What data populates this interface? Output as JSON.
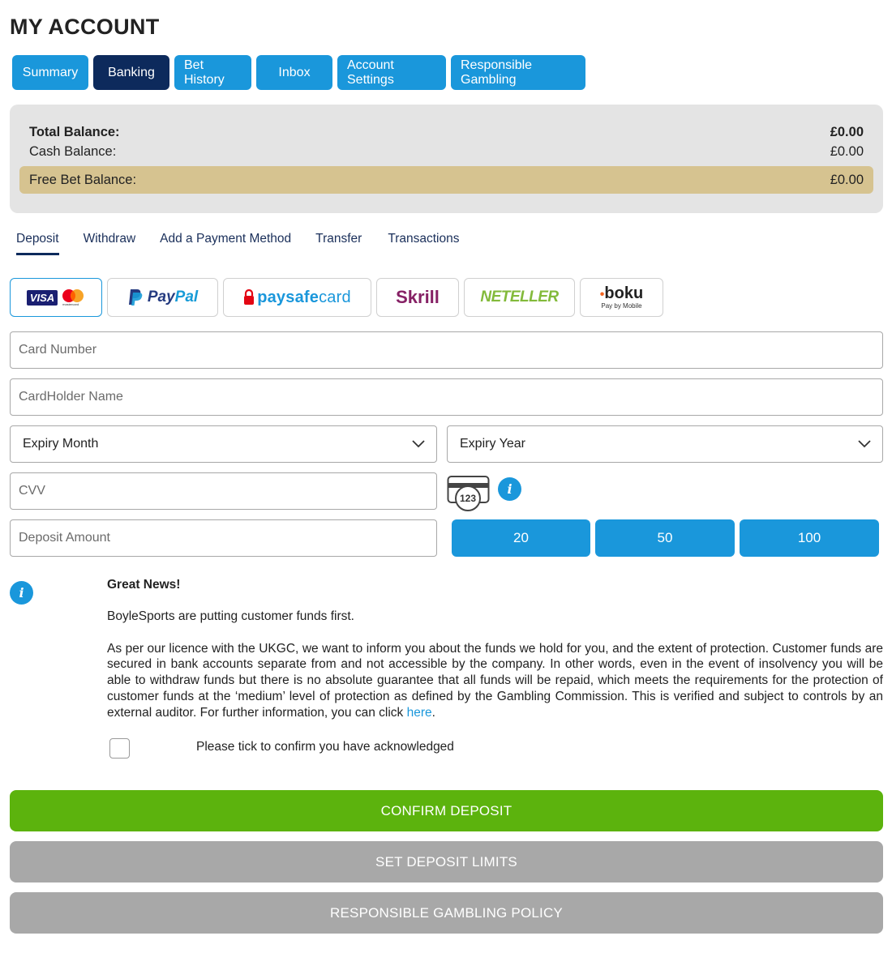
{
  "page": {
    "title": "MY ACCOUNT"
  },
  "main_tabs": [
    {
      "label": "Summary"
    },
    {
      "label": "Banking"
    },
    {
      "label": "Bet History"
    },
    {
      "label": "Inbox"
    },
    {
      "label": "Account Settings"
    },
    {
      "label": "Responsible Gambling"
    }
  ],
  "balances": {
    "total_label": "Total Balance:",
    "total_value": "£0.00",
    "cash_label": "Cash Balance:",
    "cash_value": "£0.00",
    "free_label": "Free Bet Balance:",
    "free_value": "£0.00"
  },
  "sub_tabs": [
    {
      "label": "Deposit"
    },
    {
      "label": "Withdraw"
    },
    {
      "label": "Add a Payment Method"
    },
    {
      "label": "Transfer"
    },
    {
      "label": "Transactions"
    }
  ],
  "payment_methods": {
    "visa": "VISA",
    "mastercard_small": "mastercard",
    "paypal_a": "Pay",
    "paypal_b": "Pal",
    "paysafe_a": "paysafe",
    "paysafe_b": "card",
    "skrill": "Skrill",
    "neteller": "NETELLER",
    "boku": "boku",
    "boku_sub": "Pay by Mobile"
  },
  "form": {
    "card_number_placeholder": "Card Number",
    "cardholder_placeholder": "CardHolder Name",
    "expiry_month": "Expiry Month",
    "expiry_year": "Expiry Year",
    "cvv_placeholder": "CVV",
    "cvv_card_digits": "123",
    "deposit_amount_placeholder": "Deposit Amount",
    "amounts": [
      "20",
      "50",
      "100"
    ]
  },
  "info_glyph": "i",
  "news": {
    "title": "Great News!",
    "line1": "BoyleSports are putting customer funds first.",
    "body": "As per our licence with the UKGC, we want to inform you about the funds we hold for you, and the extent of protection. Customer funds are secured in bank accounts separate from and not accessible by the company. In other words, even in the event of insolvency you will be able to withdraw funds but there is no absolute guarantee that all funds will be repaid, which meets the requirements for the protection of customer funds at the ‘medium’ level of protection as defined by the Gambling Commission. This is verified and subject to controls by an external auditor. For further information, you can click ",
    "link": "here",
    "end": "."
  },
  "acknowledge_label": "Please tick to confirm you have acknowledged",
  "buttons": {
    "confirm": "CONFIRM DEPOSIT",
    "limits": "SET DEPOSIT LIMITS",
    "policy": "RESPONSIBLE GAMBLING POLICY"
  },
  "colors": {
    "primary": "#1a97db",
    "active_tab": "#0d2a5c",
    "confirm": "#5cb30d",
    "disabled": "#a8a8a8",
    "free_bet": "#d6c390",
    "panel": "#e4e4e4"
  }
}
